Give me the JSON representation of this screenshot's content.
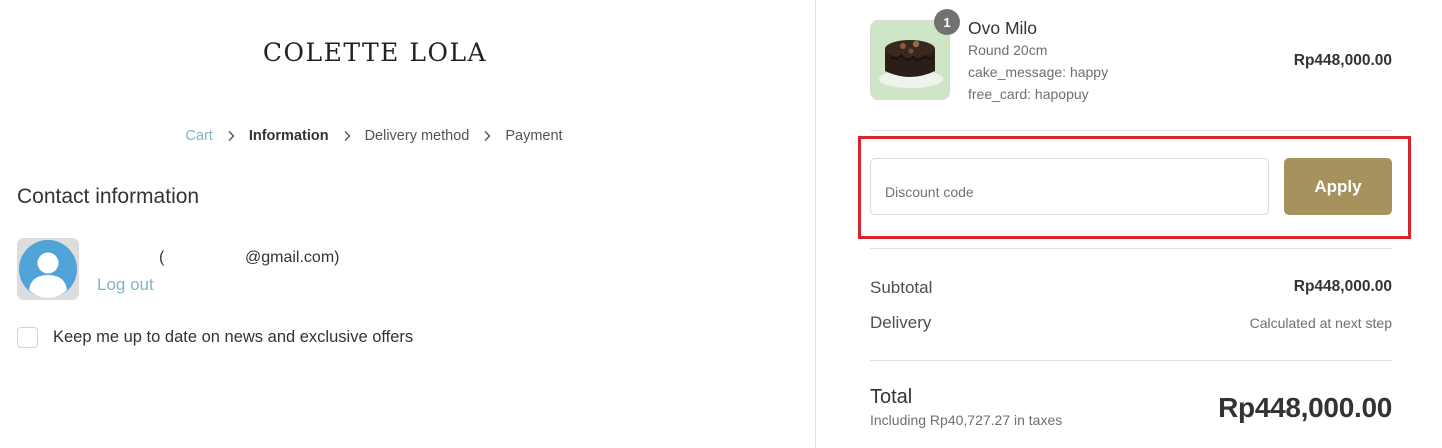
{
  "brand": {
    "logo_text": "COLETTE LOLA"
  },
  "breadcrumb": {
    "items": [
      "Cart",
      "Information",
      "Delivery method",
      "Payment"
    ]
  },
  "contact": {
    "title": "Contact information",
    "name": "",
    "open_paren": "(",
    "email": "@gmail.com)",
    "logout": "Log out",
    "newsletter_label": "Keep me up to date on news and exclusive offers",
    "newsletter_checked": false
  },
  "order": {
    "item": {
      "quantity": "1",
      "name": "Ovo Milo",
      "variant": "Round 20cm",
      "properties": [
        "cake_message: happy",
        "free_card: hapopuy"
      ],
      "price": "Rp448,000.00"
    },
    "discount": {
      "placeholder": "Discount code",
      "value": "",
      "apply_label": "Apply"
    },
    "subtotal_label": "Subtotal",
    "subtotal_value": "Rp448,000.00",
    "delivery_label": "Delivery",
    "delivery_value": "Calculated at next step",
    "total_label": "Total",
    "taxes_note": "Including Rp40,727.27 in taxes",
    "total_value": "Rp448,000.00"
  },
  "colors": {
    "accent_link": "#7fb6c4",
    "apply_button": "#a5925d",
    "highlight_border": "#d9222a",
    "qty_badge": "#727272"
  },
  "icons": {
    "breadcrumb_separator": "chevron-right-icon",
    "avatar": "user-avatar-icon"
  }
}
